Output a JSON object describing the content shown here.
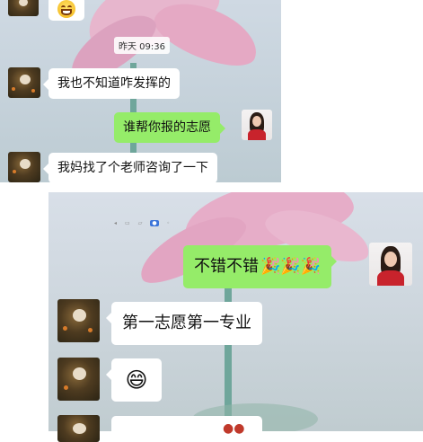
{
  "top": {
    "timestamp": "昨天 09:36",
    "messages": [
      {
        "side": "left",
        "text": "我也不知道咋发挥的"
      },
      {
        "side": "right",
        "text": "谁帮你报的志愿"
      },
      {
        "side": "left",
        "text": "我妈找了个老师咨询了一下"
      }
    ],
    "emoji": "😂"
  },
  "bottom": {
    "messages": [
      {
        "side": "right",
        "text": "不错不错",
        "emoji": "🎉🎉🎉"
      },
      {
        "side": "left",
        "text": "第一志愿第一专业"
      },
      {
        "side": "left",
        "emoji": "😄"
      }
    ]
  },
  "colors": {
    "bubble_green": "#95ec69",
    "bubble_white": "#ffffff"
  }
}
